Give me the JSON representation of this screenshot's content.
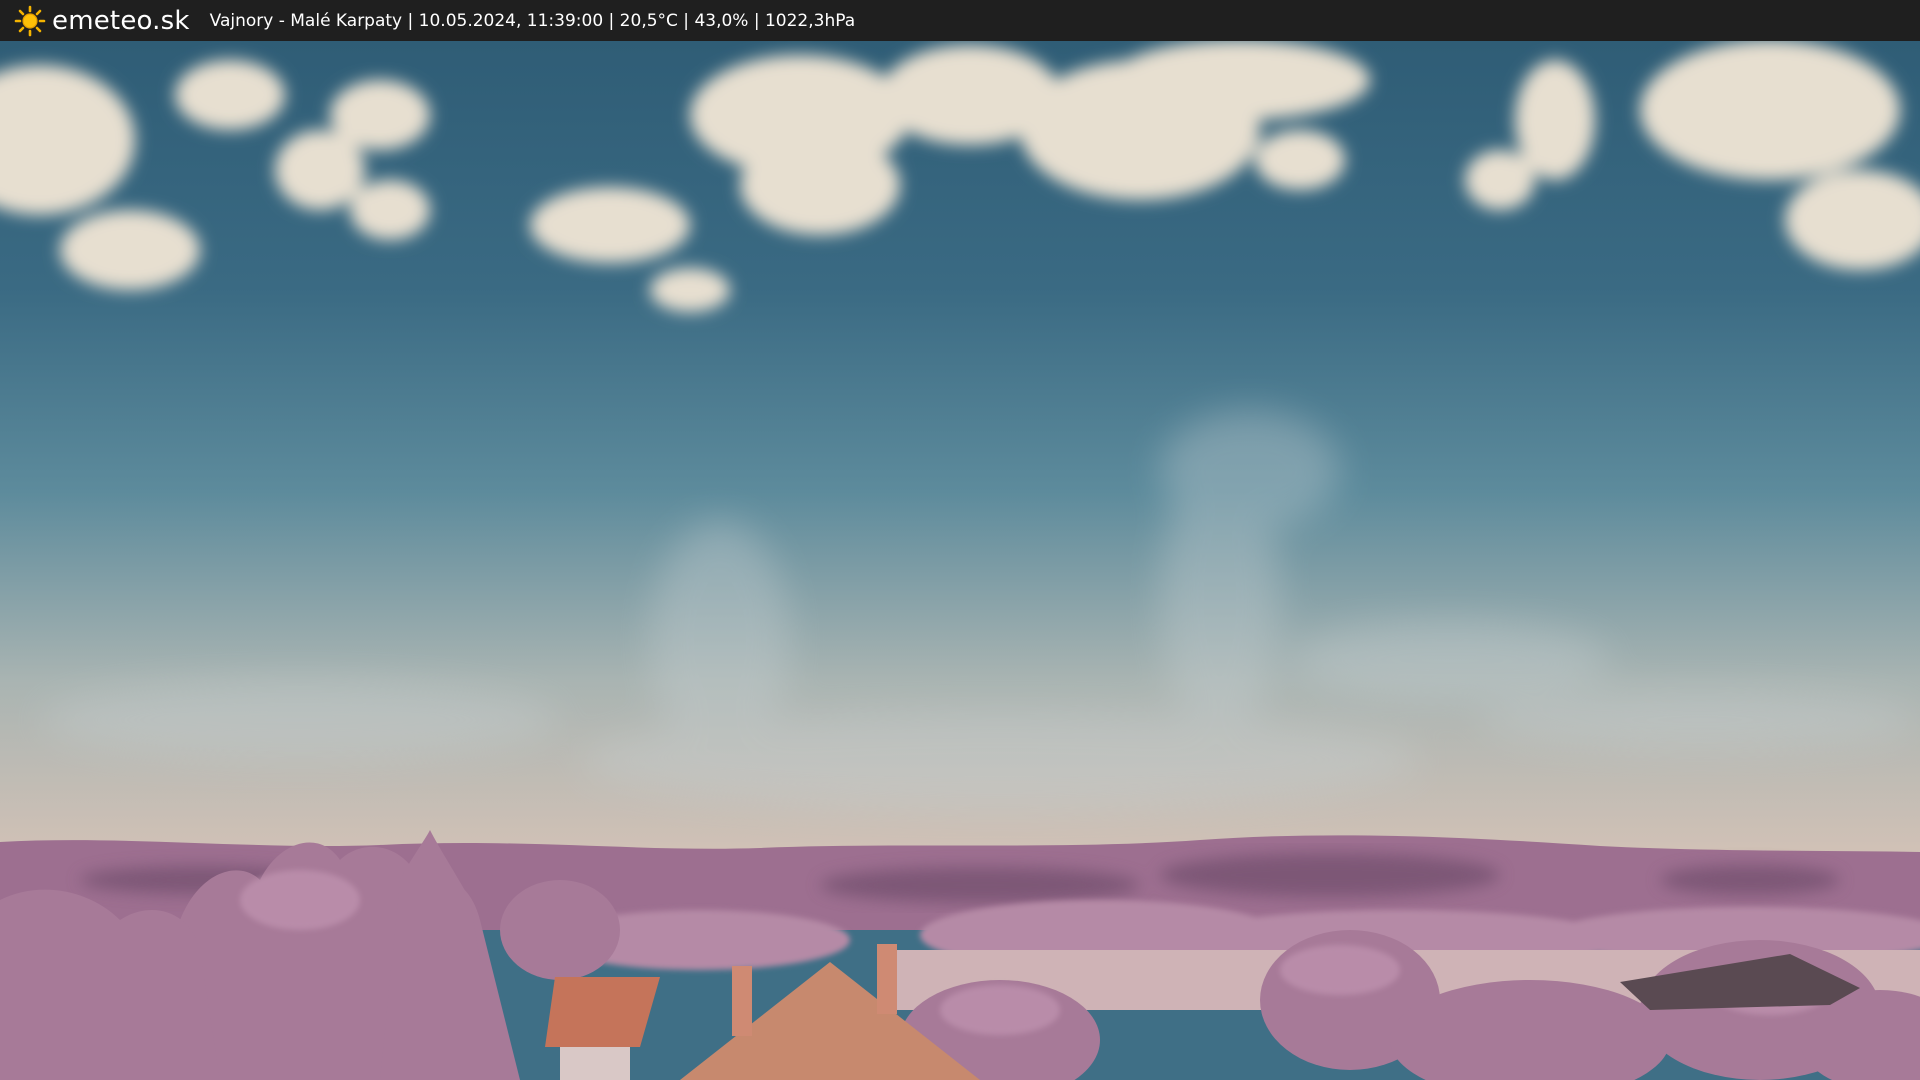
{
  "header": {
    "brand": "emeteo.sk",
    "logo_icon": "sun-icon",
    "status_text": "Vajnory - Malé Karpaty | 10.05.2024, 11:39:00 | 20,5°C | 43,0% | 1022,3hPa"
  },
  "colors": {
    "header_bg": "#1f1f1f",
    "sky_top": "#36647d",
    "sky_horizon": "#cfc0b3",
    "hills": "#9d708f",
    "foliage": "#b0809f",
    "roof": "#c5745a"
  }
}
